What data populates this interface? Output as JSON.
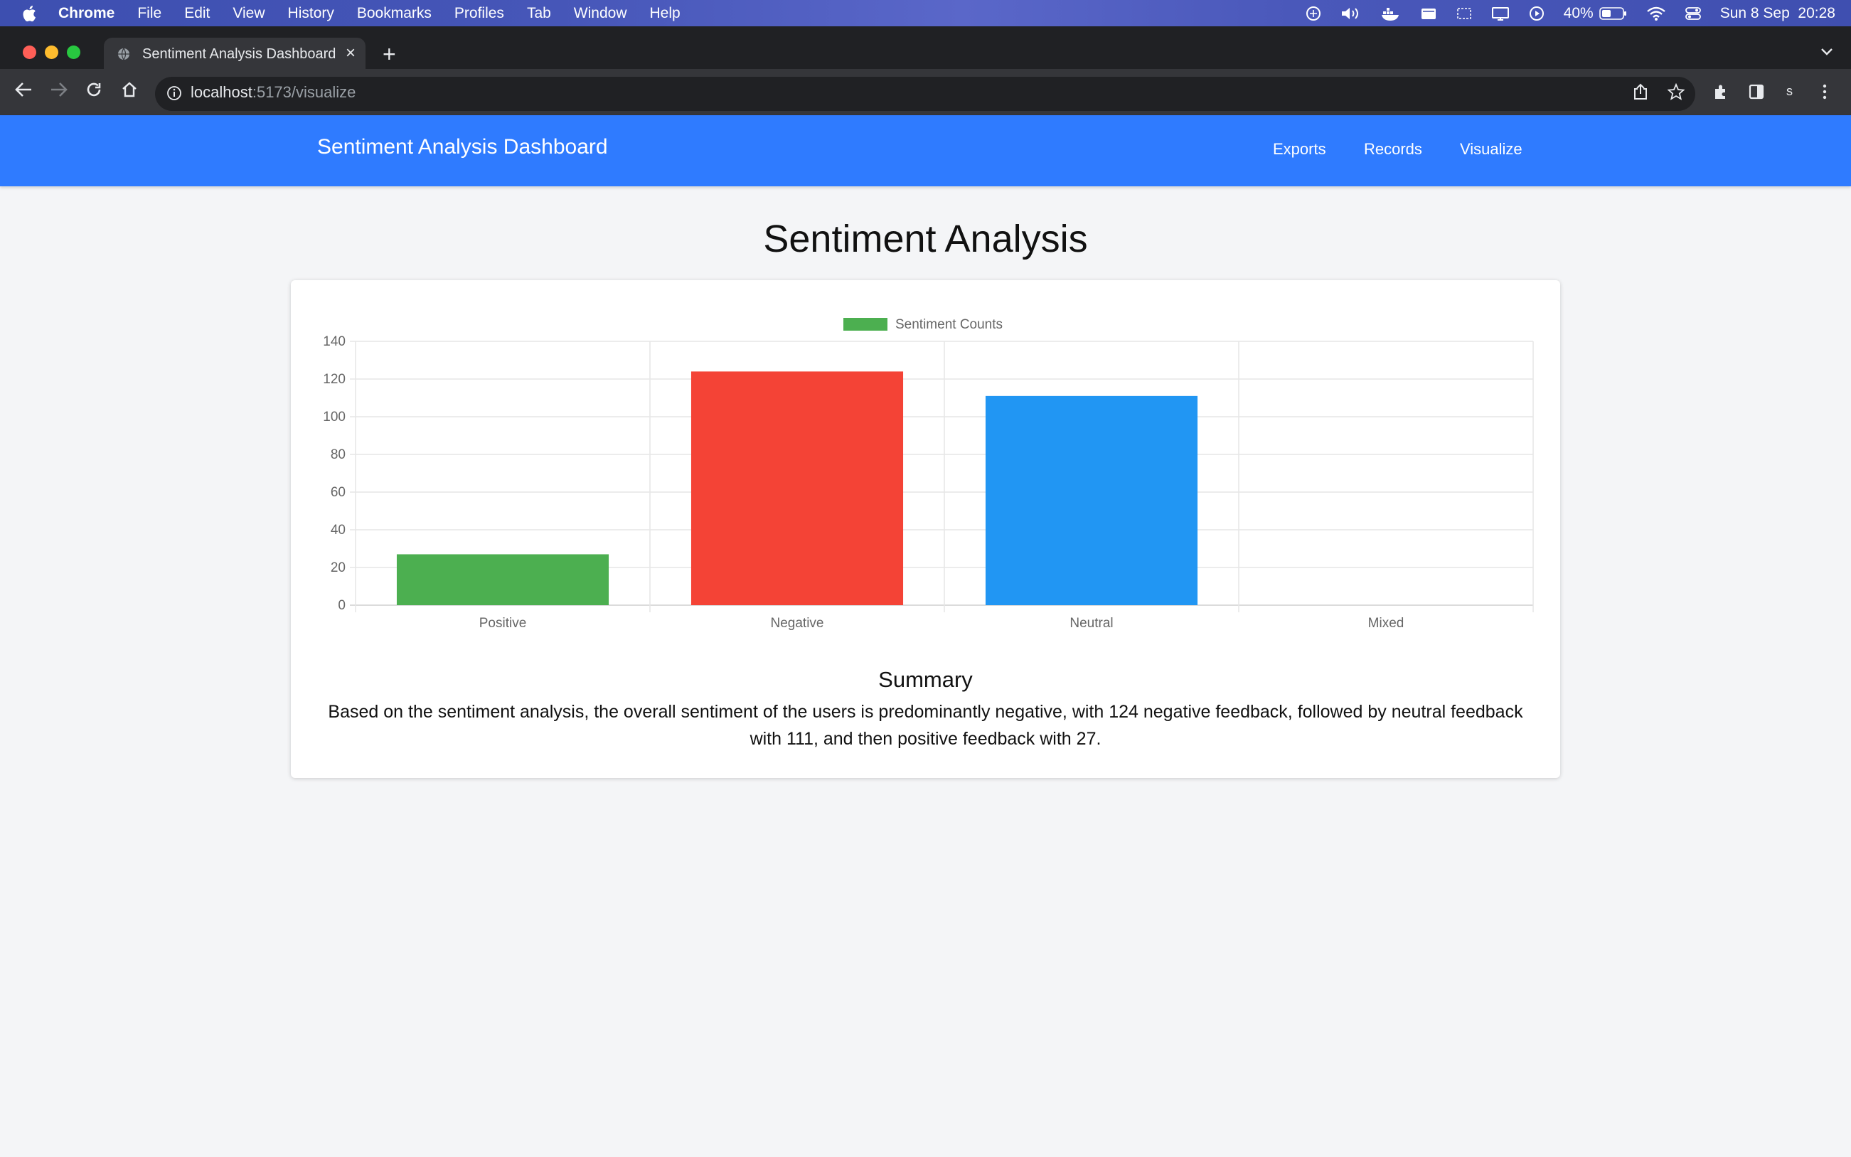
{
  "menubar": {
    "app_name": "Chrome",
    "items": [
      "File",
      "Edit",
      "View",
      "History",
      "Bookmarks",
      "Profiles",
      "Tab",
      "Window",
      "Help"
    ],
    "battery": "40%",
    "datetime": "Sun 8 Sep  20:28"
  },
  "browser": {
    "tab_title": "Sentiment Analysis Dashboard",
    "url_host": "localhost",
    "url_path": ":5173/visualize",
    "profile_initial": "s"
  },
  "navbar": {
    "brand": "Sentiment Analysis Dashboard",
    "links": [
      "Exports",
      "Records",
      "Visualize"
    ],
    "color": "#2f7bff"
  },
  "page": {
    "title": "Sentiment Analysis",
    "summary_title": "Summary",
    "summary_text": "Based on the sentiment analysis, the overall sentiment of the users is predominantly negative, with 124 negative feedback, followed by neutral feedback with 111, and then positive feedback with 27."
  },
  "chart_data": {
    "type": "bar",
    "categories": [
      "Positive",
      "Negative",
      "Neutral",
      "Mixed"
    ],
    "series": [
      {
        "name": "Sentiment Counts",
        "values": [
          27,
          124,
          111,
          0
        ],
        "colors": [
          "#4caf50",
          "#f44336",
          "#2196f3",
          "#ff9800"
        ]
      }
    ],
    "legend_color": "#4caf50",
    "ylim": [
      0,
      140
    ],
    "yticks": [
      0,
      20,
      40,
      60,
      80,
      100,
      120,
      140
    ],
    "grid": true,
    "legend": "top-center"
  }
}
